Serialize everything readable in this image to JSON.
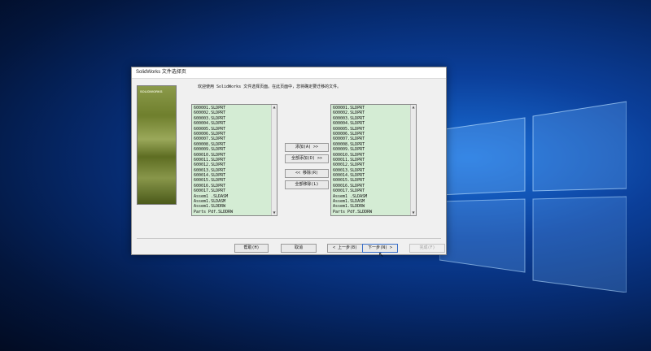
{
  "dialog": {
    "title": "SolidWorks 文件选择页",
    "banner_text": "SOLIDWORKS",
    "intro": "欢迎使用 SolidWorks 文件选择页面。在此页面中，您将确定要迁移的文件。"
  },
  "left_list": {
    "items": [
      "600001.SLDPRT",
      "600002.SLDPRT",
      "600003.SLDPRT",
      "600004.SLDPRT",
      "600005.SLDPRT",
      "600006.SLDPRT",
      "600007.SLDPRT",
      "600008.SLDPRT",
      "600009.SLDPRT",
      "600010.SLDPRT",
      "600011.SLDPRT",
      "600012.SLDPRT",
      "600013.SLDPRT",
      "600014.SLDPRT",
      "600015.SLDPRT",
      "600016.SLDPRT",
      "600017.SLDPRT",
      "Assem1 .SLDASM",
      "Assem1.SLDASM",
      "Assem1.SLDDRW",
      "Parts Pdf.SLDDRW"
    ]
  },
  "right_list": {
    "items": [
      "600001.SLDPRT",
      "600002.SLDPRT",
      "600003.SLDPRT",
      "600004.SLDPRT",
      "600005.SLDPRT",
      "600006.SLDPRT",
      "600007.SLDPRT",
      "600008.SLDPRT",
      "600009.SLDPRT",
      "600010.SLDPRT",
      "600011.SLDPRT",
      "600012.SLDPRT",
      "600013.SLDPRT",
      "600014.SLDPRT",
      "600015.SLDPRT",
      "600016.SLDPRT",
      "600017.SLDPRT",
      "Assem1 .SLDASM",
      "Assem1.SLDASM",
      "Assem1.SLDDRW",
      "Parts Pdf.SLDDRW"
    ]
  },
  "transfer_buttons": {
    "add": "添加(A) >>",
    "add_all": "全部添加(D) >>",
    "remove": "<< 移除(R)",
    "remove_all": "全部移除(L)"
  },
  "footer_buttons": {
    "help": "帮助(H)",
    "cancel": "取消",
    "back": "< 上一步(B)",
    "next": "下一步(N) >",
    "finish": "完成(F)"
  }
}
